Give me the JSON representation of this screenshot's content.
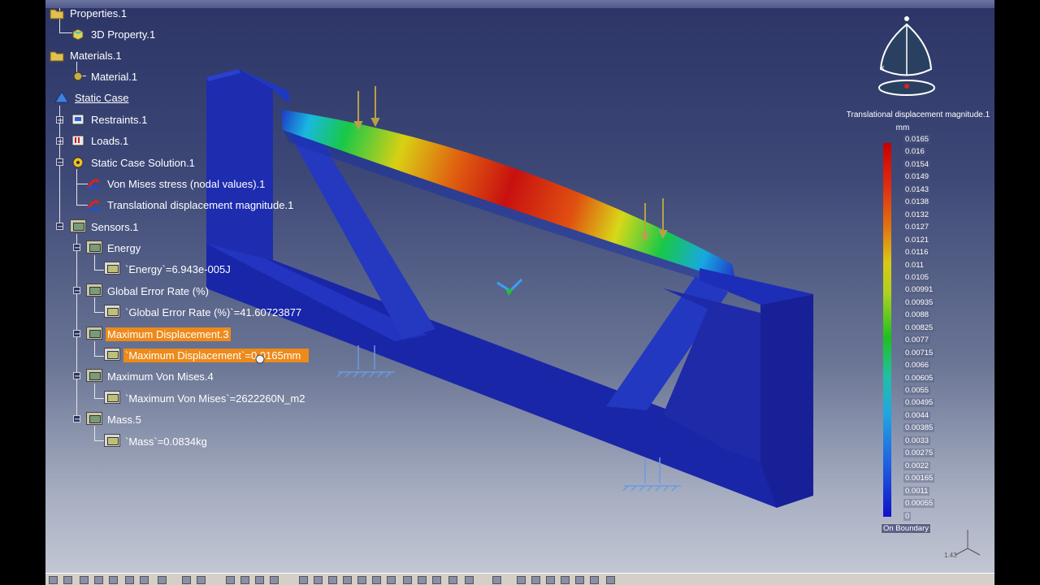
{
  "tree": {
    "nodes": [
      {
        "label": "Properties.1",
        "icon": "folder-icon"
      },
      {
        "label": "3D Property.1",
        "icon": "property-icon"
      },
      {
        "label": "Materials.1",
        "icon": "folder-icon"
      },
      {
        "label": "Material.1",
        "icon": "material-icon"
      },
      {
        "label": "Static Case",
        "icon": "static-case-icon"
      },
      {
        "label": "Restraints.1",
        "icon": "restraints-icon"
      },
      {
        "label": "Loads.1",
        "icon": "loads-icon"
      },
      {
        "label": "Static Case Solution.1",
        "icon": "solution-icon"
      },
      {
        "label": "Von Mises stress (nodal values).1",
        "icon": "image-icon"
      },
      {
        "label": "Translational displacement magnitude.1",
        "icon": "image-icon"
      },
      {
        "label": "Sensors.1",
        "icon": "sensor-icon"
      },
      {
        "label": "Energy",
        "icon": "sensor-icon"
      },
      {
        "label": "`Energy`=6.943e-005J",
        "icon": "parameter-icon"
      },
      {
        "label": "Global Error Rate (%)",
        "icon": "sensor-icon"
      },
      {
        "label": "`Global Error Rate (%)`=41.60723877",
        "icon": "parameter-icon"
      },
      {
        "label": "Maximum Displacement.3",
        "icon": "sensor-icon"
      },
      {
        "label": "`Maximum Displacement`=0.0165mm",
        "icon": "parameter-icon"
      },
      {
        "label": "Maximum Von Mises.4",
        "icon": "sensor-icon"
      },
      {
        "label": "`Maximum Von Mises`=2622260N_m2",
        "icon": "parameter-icon"
      },
      {
        "label": "Mass.5",
        "icon": "sensor-icon"
      },
      {
        "label": "`Mass`=0.0834kg",
        "icon": "parameter-icon"
      }
    ]
  },
  "legend": {
    "title": "Translational displacement magnitude.1",
    "unit": "mm",
    "values": [
      "0.0165",
      "0.016",
      "0.0154",
      "0.0149",
      "0.0143",
      "0.0138",
      "0.0132",
      "0.0127",
      "0.0121",
      "0.0116",
      "0.011",
      "0.0105",
      "0.00991",
      "0.00935",
      "0.0088",
      "0.00825",
      "0.0077",
      "0.00715",
      "0.0066",
      "0.00605",
      "0.0055",
      "0.00495",
      "0.0044",
      "0.00385",
      "0.0033",
      "0.00275",
      "0.0022",
      "0.00165",
      "0.0011",
      "0.00055",
      "0"
    ],
    "footer": "On Boundary"
  },
  "scale": "1.43",
  "colors": {
    "highlight": "#ee8a19",
    "background_top": "#2c3566"
  }
}
